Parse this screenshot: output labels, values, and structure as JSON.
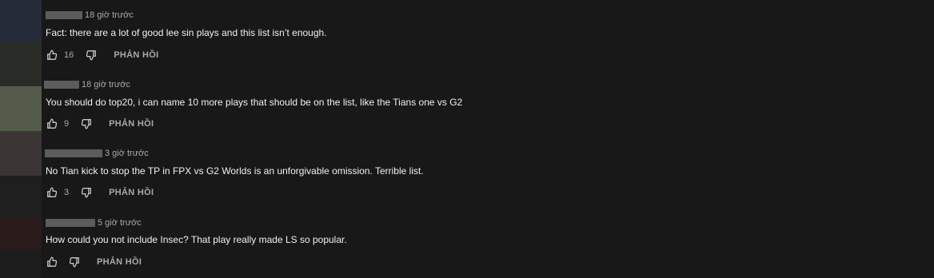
{
  "comments": [
    {
      "time": "18 giờ trước",
      "text": "Fact: there are a lot of good lee sin plays and this list isn’t enough.",
      "likes": "16",
      "reply_label": "PHẢN HỒI",
      "avatar_color": "#2a3040"
    },
    {
      "time": "18 giờ trước",
      "text": "You should do top20, i can name 10 more plays that should be on the list, like the Tians one vs G2",
      "likes": "9",
      "reply_label": "PHẢN HỒI",
      "avatar_color": "#565c4c"
    },
    {
      "time": "3 giờ trước",
      "text": "No Tian kick to stop the TP in FPX vs G2 Worlds is an unforgivable omission. Terrible list.",
      "likes": "3",
      "reply_label": "PHẢN HỒI",
      "avatar_color": "#3d3434"
    },
    {
      "time": "5 giờ trước",
      "text": "How could you not include Insec? That play really made LS so popular.",
      "likes": "",
      "reply_label": "PHẢN HỒI",
      "avatar_color": "#2c1c1c"
    }
  ],
  "icons": {
    "like": "thumbs-up-icon",
    "dislike": "thumbs-down-icon"
  },
  "colors": {
    "background": "#181818",
    "text": "#f1f1f1",
    "secondary": "#aaaaaa"
  }
}
